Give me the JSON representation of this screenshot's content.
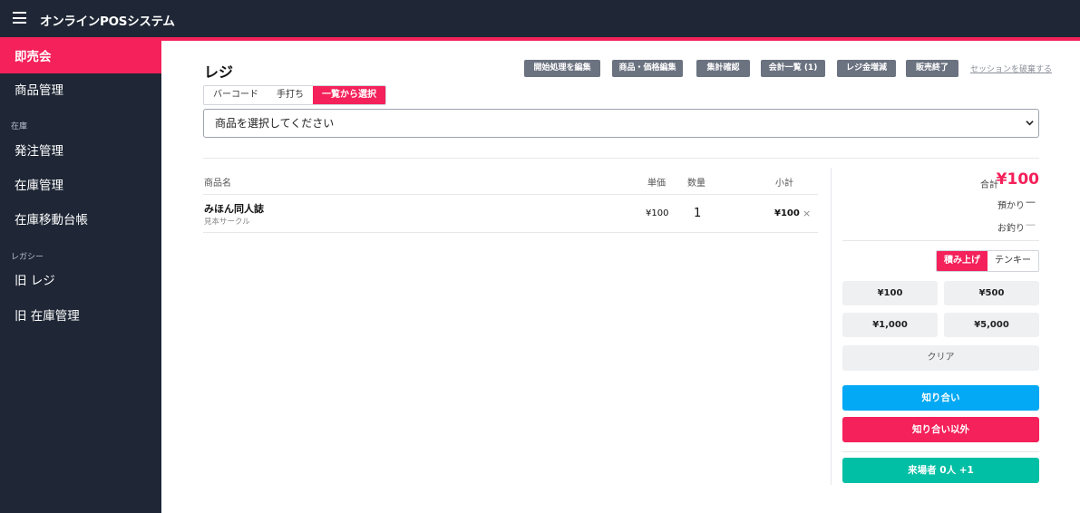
{
  "app": {
    "title": "オンラインPOSシステム"
  },
  "sidebar": {
    "items": [
      {
        "label": "即売会"
      },
      {
        "label": "商品管理"
      },
      {
        "label": "発注管理"
      },
      {
        "label": "在庫管理"
      },
      {
        "label": "在庫移動台帳"
      },
      {
        "label": "旧 レジ"
      },
      {
        "label": "旧 在庫管理"
      }
    ],
    "sections": {
      "stock": "在庫",
      "legacy": "レガシー"
    }
  },
  "page": {
    "title": "レジ"
  },
  "actions": {
    "edit_opening": "開始処理を編集",
    "edit_products": "商品・価格編集",
    "check_totals": "集計確認",
    "accounts_list": "会計一覧 (1)",
    "register_adjust": "レジ金増減",
    "end_sale": "販売終了",
    "discard_session": "セッションを破棄する"
  },
  "input_tabs": [
    "バーコード",
    "手打ち",
    "一覧から選択"
  ],
  "product_select": {
    "value": "商品を選択してください"
  },
  "cart": {
    "headers": {
      "name": "商品名",
      "unit_price": "単価",
      "qty": "数量",
      "subtotal": "小計"
    },
    "rows": [
      {
        "name": "みほん同人誌",
        "circle": "見本サークル",
        "unit_price": "¥100",
        "qty": "1",
        "subtotal": "¥100",
        "remove": "×"
      }
    ]
  },
  "summary": {
    "total_label": "合計",
    "total_value": "¥100",
    "received_label": "預かり",
    "received_value": "—",
    "change_label": "お釣り",
    "change_value": "—"
  },
  "mode_toggle": [
    "積み上げ",
    "テンキー"
  ],
  "cash_buttons": [
    "¥100",
    "¥500",
    "¥1,000",
    "¥5,000"
  ],
  "clear_label": "クリア",
  "checkout": {
    "acquaintance": "知り合い",
    "non_acquaintance": "知り合い以外",
    "visitor": "来場者 0人 +1"
  },
  "colors": {
    "accent": "#f4215a",
    "sidebar": "#1f2736",
    "acquaintance": "#03a9f4",
    "visitor": "#00bfa5",
    "action": "#6b7280"
  }
}
